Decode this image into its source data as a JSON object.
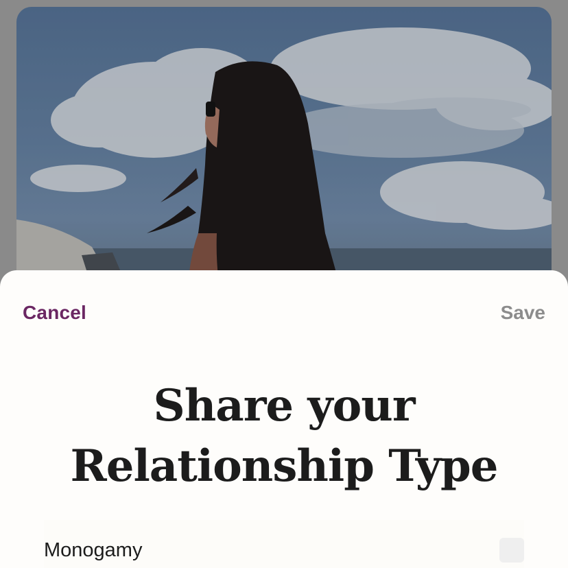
{
  "header": {
    "cancel_label": "Cancel",
    "save_label": "Save"
  },
  "title": {
    "line1": "Share your",
    "line2": "Relationship Type"
  },
  "options": [
    {
      "label": "Monogamy",
      "checked": false
    }
  ],
  "colors": {
    "accent": "#6b2763",
    "save_disabled": "#8c8c8c",
    "sheet_background": "#fefdfb",
    "title_text": "#1c1c1c"
  }
}
